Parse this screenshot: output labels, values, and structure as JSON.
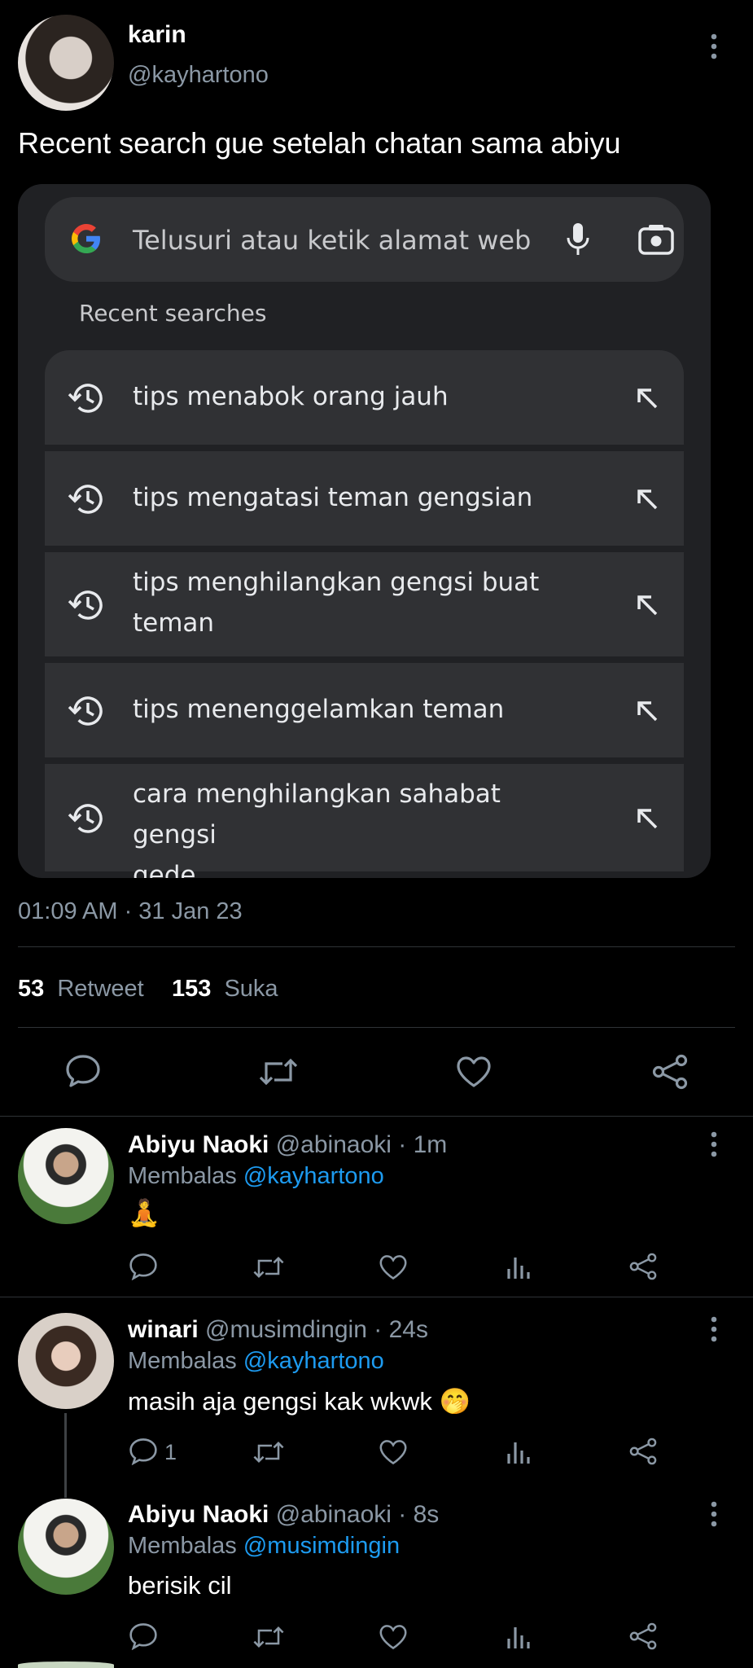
{
  "tweet": {
    "author_name": "karin",
    "author_handle": "@kayhartono",
    "text": "Recent search gue setelah chatan sama abiyu",
    "timestamp": "01:09 AM · 31 Jan 23",
    "retweets_count": "53",
    "retweets_label": "Retweet",
    "likes_count": "153",
    "likes_label": "Suka"
  },
  "screenshot": {
    "search_placeholder": "Telusuri atau ketik alamat web",
    "recent_title": "Recent searches",
    "items": [
      {
        "line1": "tips menabok orang jauh",
        "line2": ""
      },
      {
        "line1": "tips mengatasi teman gengsian",
        "line2": ""
      },
      {
        "line1": "tips menghilangkan gengsi buat",
        "line2": "teman"
      },
      {
        "line1": "tips menenggelamkan teman",
        "line2": ""
      },
      {
        "line1": "cara menghilangkan sahabat gengsi",
        "line2": "gede"
      }
    ]
  },
  "replies": [
    {
      "name": "Abiyu Naoki",
      "handle": "@abinaoki",
      "time": "· 1m",
      "replying_label": "Membalas",
      "replying_to": "@kayhartono",
      "text": "🧘",
      "reply_count": ""
    },
    {
      "name": "winari",
      "handle": "@musimdingin",
      "time": "· 24s",
      "replying_label": "Membalas",
      "replying_to": "@kayhartono",
      "text": "masih aja gengsi kak wkwk 🤭",
      "reply_count": "1"
    },
    {
      "name": "Abiyu Naoki",
      "handle": "@abinaoki",
      "time": "· 8s",
      "replying_label": "Membalas",
      "replying_to": "@musimdingin",
      "text": "berisik cil",
      "reply_count": ""
    }
  ],
  "colors": {
    "background": "#000000",
    "link": "#1d9bf0",
    "muted": "#8b98a5",
    "divider": "#2f3336"
  }
}
